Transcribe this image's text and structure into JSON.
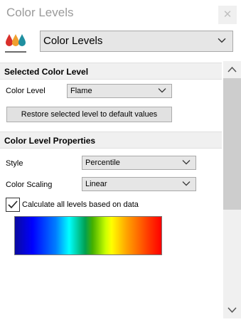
{
  "window": {
    "title": "Color Levels",
    "close_icon": "close-icon"
  },
  "header": {
    "icon": "color-drops-icon",
    "selected": "Color Levels"
  },
  "selected_color_level": {
    "section_title": "Selected Color Level",
    "color_level_label": "Color Level",
    "color_level_value": "Flame",
    "restore_button": "Restore selected level to default values"
  },
  "color_level_properties": {
    "section_title": "Color Level Properties",
    "style_label": "Style",
    "style_value": "Percentile",
    "scaling_label": "Color Scaling",
    "scaling_value": "Linear",
    "calculate_label": "Calculate all levels based on data",
    "calculate_checked": true
  },
  "colors": {
    "drop_red": "#d9302b",
    "drop_orange": "#f0a030",
    "drop_teal": "#1f8fa0"
  }
}
